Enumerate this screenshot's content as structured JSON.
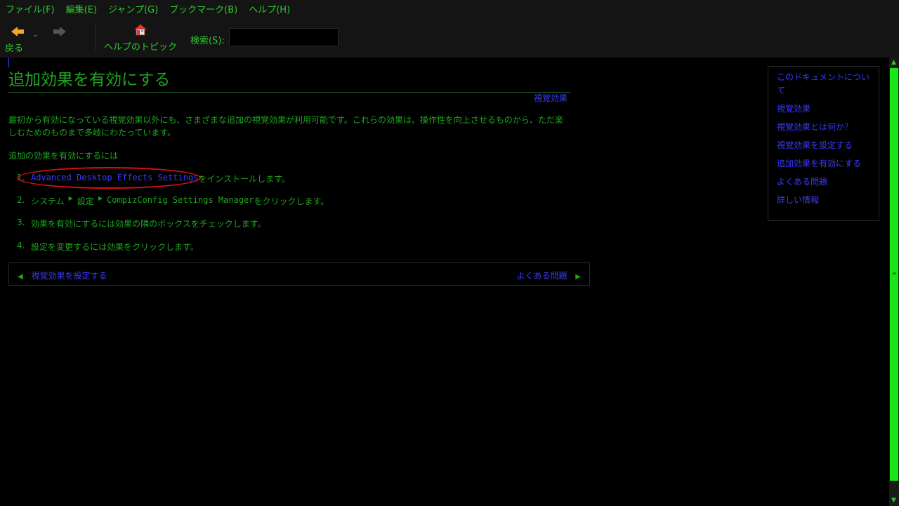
{
  "menubar": {
    "items": [
      "ファイル(F)",
      "編集(E)",
      "ジャンプ(G)",
      "ブックマーク(B)",
      "ヘルプ(H)"
    ]
  },
  "toolbar": {
    "back_label": "戻る",
    "topics_label": "ヘルプのトピック",
    "search_label": "検索(S):",
    "search_value": ""
  },
  "page": {
    "title": "追加効果を有効にする",
    "parent_link": "視覚効果",
    "intro": "最初から有効になっている視覚効果以外にも、さまざまな追加の視覚効果が利用可能です。これらの効果は、操作性を向上させるものから、ただ楽しむためのものまで多岐にわたっています。",
    "steps_heading": "追加の効果を有効にするには",
    "steps": {
      "s1": {
        "num": "1.",
        "link": "Advanced Desktop Effects Settings",
        "text": "をインストールします。"
      },
      "s2": {
        "num": "2.",
        "menu1": "システム",
        "menu2": "設定",
        "menu3": "CompizConfig Settings Manager",
        "text": "をクリックします。"
      },
      "s3": {
        "num": "3.",
        "text": "効果を有効にするには効果の隣のボックスをチェックします。"
      },
      "s4": {
        "num": "4.",
        "text": "設定を変更するには効果をクリックします。"
      }
    },
    "nav": {
      "prev": "視覚効果を設定する",
      "next": "よくある問題"
    }
  },
  "sidebar": {
    "items": [
      "このドキュメントについて",
      "視覚効果",
      "視覚効果とは何か？",
      "視覚効果を設定する",
      "追加効果を有効にする",
      "よくある問題",
      "詳しい情報"
    ]
  },
  "colors": {
    "text": "#1fa51f",
    "link": "#3a3aff",
    "annotation": "#d81010",
    "scrollbar": "#19e619",
    "back_arrow": "#f5a623"
  }
}
